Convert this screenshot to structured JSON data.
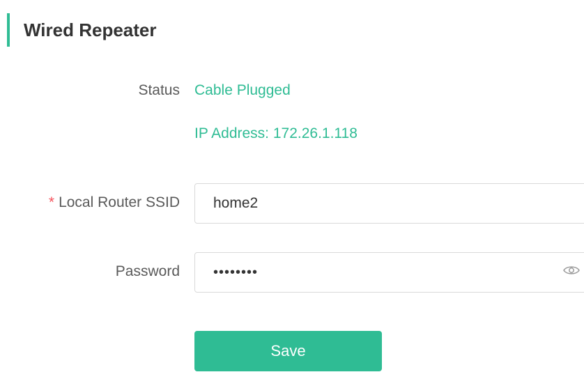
{
  "section": {
    "title": "Wired Repeater"
  },
  "status": {
    "label": "Status",
    "value": "Cable Plugged",
    "ip_text": "IP Address: 172.26.1.118"
  },
  "ssid_field": {
    "required_mark": "*",
    "label": "Local Router SSID",
    "value": "home2"
  },
  "password_field": {
    "label": "Password",
    "masked_value": "••••••••",
    "toggle_icon": "eye-icon"
  },
  "actions": {
    "save_label": "Save"
  },
  "colors": {
    "accent": "#2fbc94",
    "required": "#f5525c",
    "label": "#595959",
    "title": "#333333"
  }
}
